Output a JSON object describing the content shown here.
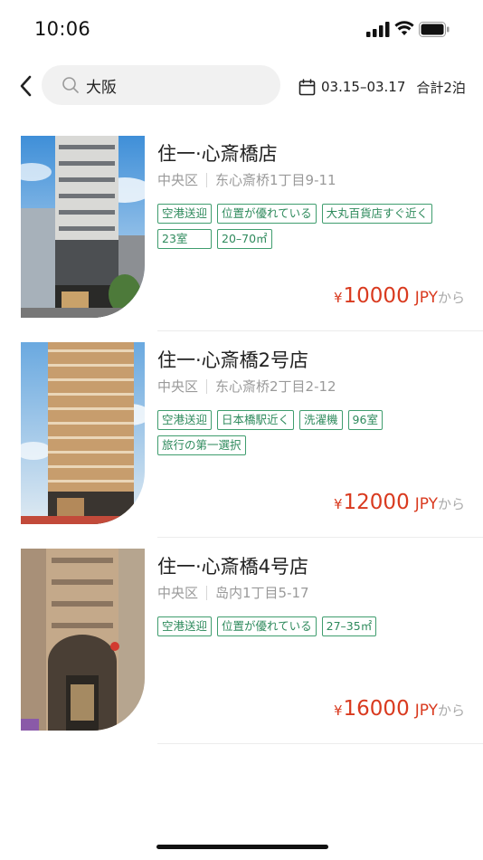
{
  "status_bar": {
    "time": "10:06",
    "icons": [
      "signal-icon",
      "wifi-icon",
      "battery-icon"
    ]
  },
  "header": {
    "back_icon": "chevron-left-icon",
    "search_icon": "search-icon",
    "search_value": "大阪",
    "calendar_icon": "calendar-icon",
    "date_range": "03.15–03.17",
    "nights": "合計2泊"
  },
  "colors": {
    "accent_red": "#d93a1f",
    "tag_green": "#2e8a5c",
    "muted_gray": "#9a9a9a"
  },
  "hotels": [
    {
      "name": "住一·心斎橋店",
      "district": "中央区",
      "address": "东心斎桥1丁目9-11",
      "tags": [
        "空港送迎",
        "位置が優れている",
        "大丸百貨店すぐ近く",
        "23室",
        "20–70㎡"
      ],
      "currency": "¥",
      "price": "10000",
      "unit": "JPY",
      "suffix": "から"
    },
    {
      "name": "住一·心斎橋2号店",
      "district": "中央区",
      "address": "东心斎桥2丁目2-12",
      "tags": [
        "空港送迎",
        "日本橋駅近く",
        "洗濯機",
        "96室",
        "旅行の第一選択"
      ],
      "currency": "¥",
      "price": "12000",
      "unit": "JPY",
      "suffix": "から"
    },
    {
      "name": "住一·心斎橋4号店",
      "district": "中央区",
      "address": "岛内1丁目5-17",
      "tags": [
        "空港送迎",
        "位置が優れている",
        "27–35㎡"
      ],
      "currency": "¥",
      "price": "16000",
      "unit": "JPY",
      "suffix": "から"
    }
  ]
}
